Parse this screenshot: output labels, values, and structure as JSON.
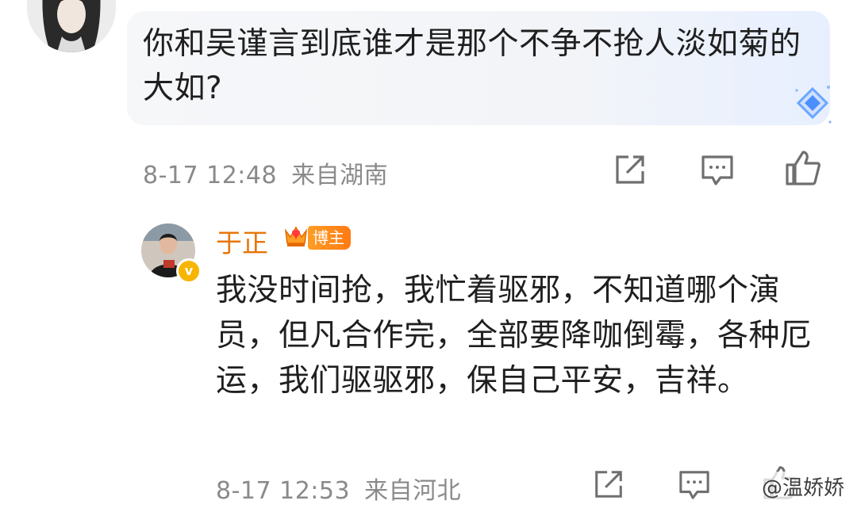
{
  "comment": {
    "text": "你和吴谨言到底谁才是那个不争不抢人淡如菊的大如?",
    "time": "8-17 12:48",
    "location": "来自湖南"
  },
  "reply": {
    "username": "于正",
    "badge": "博主",
    "verified_mark": "v",
    "text": "我没时间抢，我忙着驱邪，不知道哪个演员，但凡合作完，全部要降咖倒霉，各种厄运，我们驱驱邪，保自己平安，吉祥。",
    "time": "8-17 12:53",
    "location": "来自河北"
  },
  "watermark": "@温娇娇",
  "colors": {
    "username": "#e8750a",
    "badge": "#ff8a1c",
    "meta": "#8a8a8a"
  },
  "icons": [
    "share-icon",
    "comment-icon",
    "like-icon",
    "diamond-sparkle-icon",
    "crown-icon"
  ]
}
